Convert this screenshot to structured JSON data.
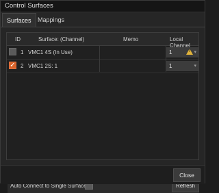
{
  "window": {
    "title": "Control Surfaces"
  },
  "tabs": [
    {
      "label": "Surfaces",
      "active": true
    },
    {
      "label": "Mappings",
      "active": false
    }
  ],
  "table": {
    "headers": {
      "id": "ID",
      "surface": "Surface: (Channel)",
      "memo": "Memo",
      "local_channel": "Local Channel"
    },
    "rows": [
      {
        "checked": false,
        "id": "1",
        "surface": "VMC1 4S (In Use)",
        "memo": "",
        "local_channel": "1",
        "warning": true
      },
      {
        "checked": true,
        "id": "2",
        "surface": "VMC1 2S: 1",
        "memo": "",
        "local_channel": "1",
        "warning": false
      }
    ]
  },
  "options": {
    "auto_connect_label": "Auto Connect to Single Surface",
    "auto_connect_checked": false,
    "refresh_label": "Refresh"
  },
  "footer": {
    "close_label": "Close"
  },
  "colors": {
    "accent": "#d9632a",
    "warning": "#e2b43b"
  }
}
